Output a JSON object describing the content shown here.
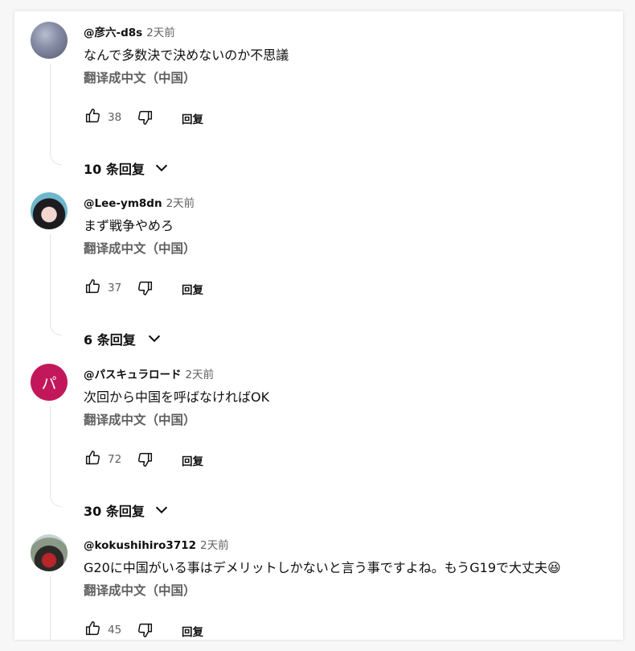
{
  "comments": [
    {
      "author": "@彦六-d8s",
      "time": "2天前",
      "text": "なんで多数決で決めないのか不思議",
      "translate": "翻译成中文（中国）",
      "likes": "38",
      "reply": "回复",
      "replies": "10 条回复",
      "avatar_letter": ""
    },
    {
      "author": "@Lee-ym8dn",
      "time": "2天前",
      "text": "まず戦争やめろ",
      "translate": "翻译成中文（中国）",
      "likes": "37",
      "reply": "回复",
      "replies": "6 条回复",
      "avatar_letter": ""
    },
    {
      "author": "@パスキュラロード",
      "time": "2天前",
      "text": "次回から中国を呼ばなければOK",
      "translate": "翻译成中文（中国）",
      "likes": "72",
      "reply": "回复",
      "replies": "30 条回复",
      "avatar_letter": "パ"
    },
    {
      "author": "@kokushihiro3712",
      "time": "2天前",
      "text": "G20に中国がいる事はデメリットしかないと言う事ですよね。もうG19で大丈夫😆",
      "translate": "翻译成中文（中国）",
      "likes": "45",
      "reply": "回复",
      "replies": "",
      "avatar_letter": ""
    }
  ],
  "colors": {
    "text_primary": "#0f0f0f",
    "text_secondary": "#606060",
    "avatar_letter_bg": "#c2185b"
  },
  "icons": [
    "thumb-up-icon",
    "thumb-down-icon",
    "chevron-down-icon"
  ]
}
